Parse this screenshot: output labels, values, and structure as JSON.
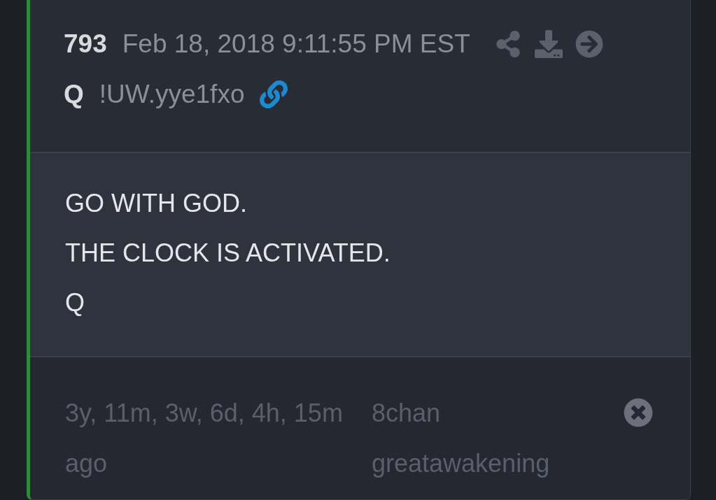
{
  "post": {
    "number": "793",
    "timestamp": "Feb 18, 2018 9:11:55 PM EST",
    "author": "Q",
    "tripcode": "!UW.yye1fxo"
  },
  "body": {
    "lines": [
      "GO WITH GOD.",
      "THE CLOCK IS ACTIVATED.",
      "Q"
    ]
  },
  "footer": {
    "age": "3y, 11m, 3w, 6d, 4h, 15m ago",
    "site": "8chan",
    "board": "greatawakening"
  }
}
